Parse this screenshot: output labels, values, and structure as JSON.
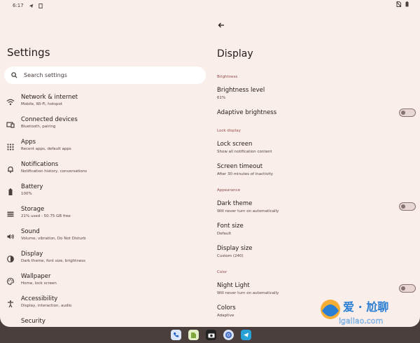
{
  "status_bar": {
    "time": "6:17"
  },
  "left": {
    "title": "Settings",
    "search": {
      "placeholder": "Search settings"
    },
    "items": [
      {
        "title": "Network & internet",
        "subtitle": "Mobile, Wi-Fi, hotspot",
        "icon": "wifi-icon"
      },
      {
        "title": "Connected devices",
        "subtitle": "Bluetooth, pairing",
        "icon": "devices-icon"
      },
      {
        "title": "Apps",
        "subtitle": "Recent apps, default apps",
        "icon": "apps-grid-icon"
      },
      {
        "title": "Notifications",
        "subtitle": "Notification history, conversations",
        "icon": "bell-icon"
      },
      {
        "title": "Battery",
        "subtitle": "100%",
        "icon": "battery-icon"
      },
      {
        "title": "Storage",
        "subtitle": "21% used - 50.75 GB free",
        "icon": "storage-icon"
      },
      {
        "title": "Sound",
        "subtitle": "Volume, vibration, Do Not Disturb",
        "icon": "volume-icon"
      },
      {
        "title": "Display",
        "subtitle": "Dark theme, font size, brightness",
        "icon": "display-icon"
      },
      {
        "title": "Wallpaper",
        "subtitle": "Home, lock screen",
        "icon": "palette-icon"
      },
      {
        "title": "Accessibility",
        "subtitle": "Display, interaction, audio",
        "icon": "accessibility-icon"
      },
      {
        "title": "Security",
        "subtitle": "",
        "icon": "security-icon"
      }
    ]
  },
  "right": {
    "title": "Display",
    "sections": {
      "brightness": "Brightness",
      "lock_display": "Lock display",
      "appearance": "Appearance",
      "color": "Color"
    },
    "brightness_level": {
      "title": "Brightness level",
      "subtitle": "61%"
    },
    "adaptive_brightness": {
      "title": "Adaptive brightness",
      "enabled": false
    },
    "lock_screen": {
      "title": "Lock screen",
      "subtitle": "Show all notification content"
    },
    "screen_timeout": {
      "title": "Screen timeout",
      "subtitle": "After 30 minutes of inactivity"
    },
    "dark_theme": {
      "title": "Dark theme",
      "subtitle": "Will never turn on automatically",
      "enabled": false
    },
    "font_size": {
      "title": "Font size",
      "subtitle": "Default"
    },
    "display_size": {
      "title": "Display size",
      "subtitle": "Custom (240)"
    },
    "night_light": {
      "title": "Night Light",
      "subtitle": "Will never turn on automatically",
      "enabled": false
    },
    "colors": {
      "title": "Colors",
      "subtitle": "Adaptive"
    }
  },
  "dock": [
    "phone-app",
    "files-app",
    "camera-app",
    "chrome-app",
    "telegram-app"
  ],
  "watermark": {
    "text": "爱 · 尬聊",
    "url": "igaliao.com"
  },
  "colors": {
    "background": "#faeeea",
    "accent": "#8f4a4b",
    "taskbar": "#4a3f3d"
  }
}
